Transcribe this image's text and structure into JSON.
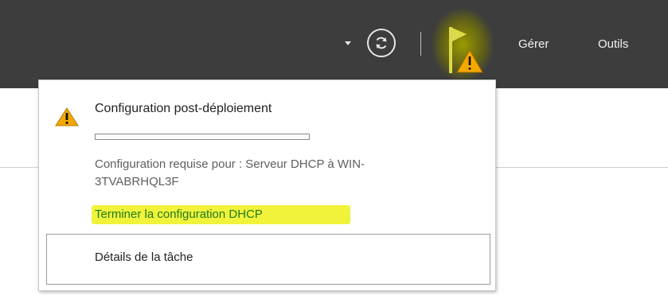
{
  "toolbar": {
    "menu_items": [
      "Gérer",
      "Outils"
    ],
    "flag_highlight_color": "#b0b000",
    "icons": [
      "chevron-down-icon",
      "refresh-icon",
      "notification-flag-icon",
      "warning-icon"
    ]
  },
  "notification": {
    "title": "Configuration post-déploiement",
    "progress": 0,
    "description": "Configuration requise pour : Serveur DHCP à WIN-3TVABRHQL3F",
    "action_link": "Terminer la configuration DHCP",
    "highlight_color": "#f0f33a",
    "link_color": "#217a1e",
    "task_details_label": "Détails de la tâche"
  }
}
